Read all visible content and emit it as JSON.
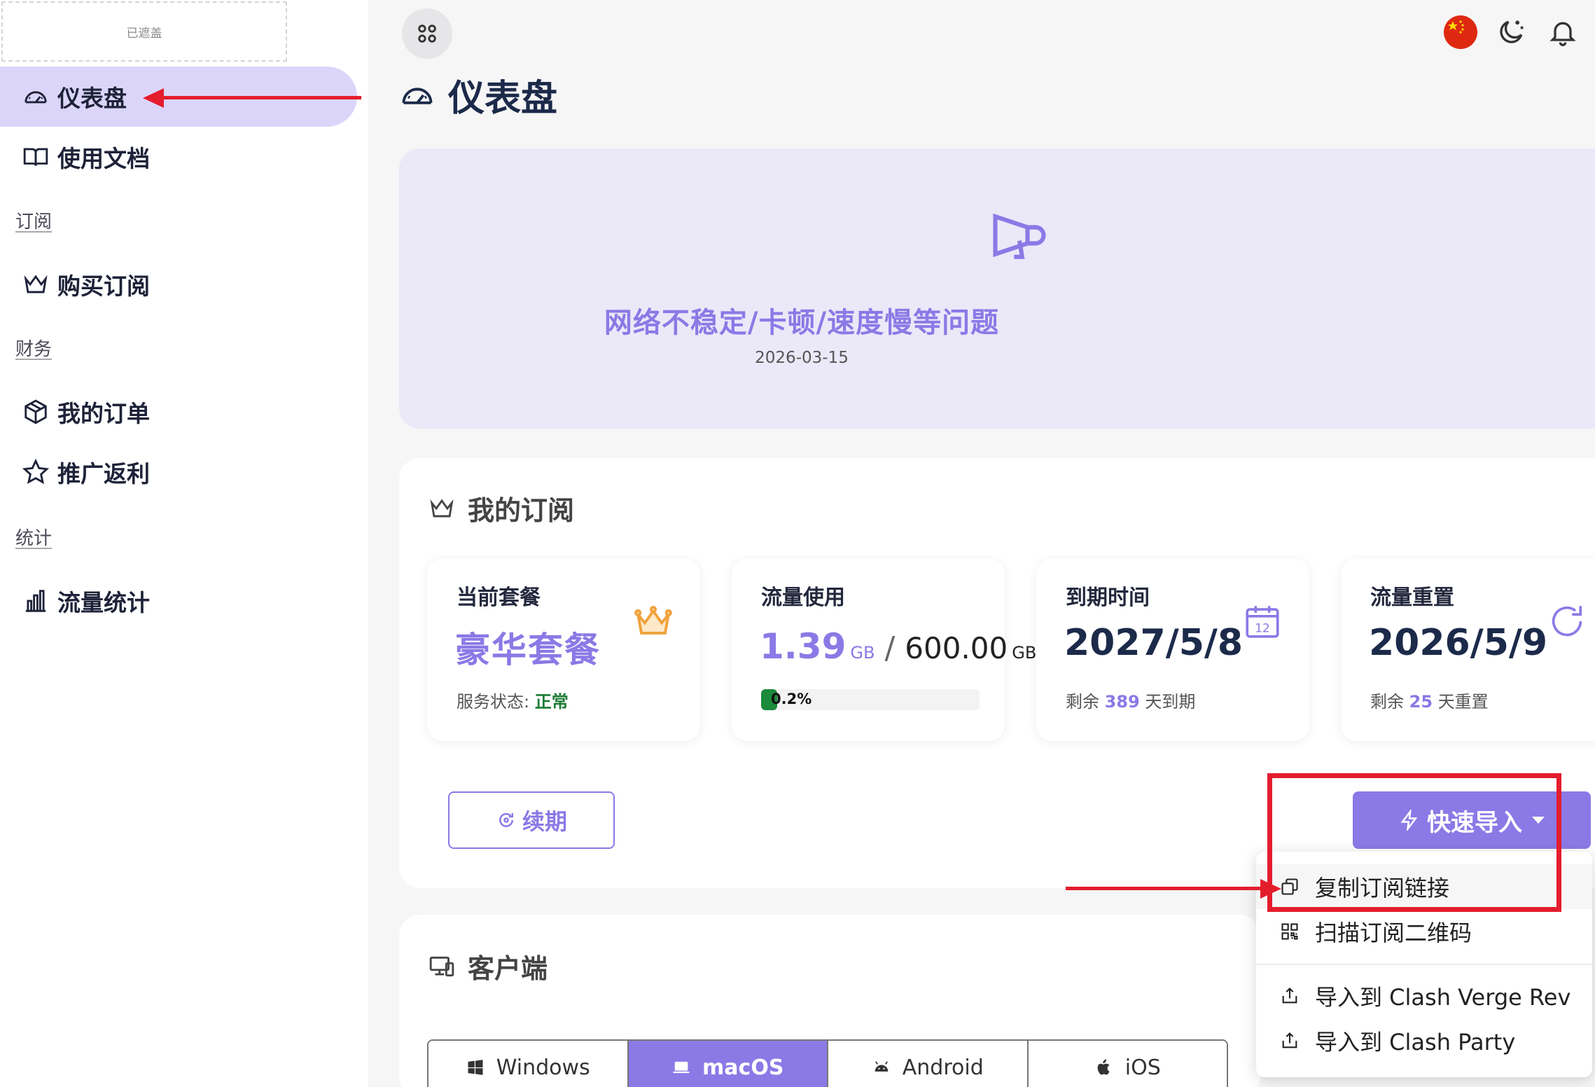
{
  "sidebar": {
    "logo_placeholder": "已遮盖",
    "items": [
      {
        "label": "仪表盘",
        "icon": "dashboard-icon",
        "active": true
      },
      {
        "label": "使用文档",
        "icon": "book-icon"
      },
      {
        "label": "购买订阅",
        "icon": "crown-icon"
      },
      {
        "label": "我的订单",
        "icon": "package-icon"
      },
      {
        "label": "推广返利",
        "icon": "star-icon"
      },
      {
        "label": "流量统计",
        "icon": "bar-chart-icon"
      }
    ],
    "groups": [
      "订阅",
      "财务",
      "统计"
    ]
  },
  "header": {
    "title": "仪表盘",
    "icons": [
      "grid-icon",
      "china-flag-icon",
      "moon-stars-icon",
      "bell-icon"
    ]
  },
  "announcement": {
    "title": "网络不稳定/卡顿/速度慢等问题",
    "date": "2026-03-15",
    "icon": "megaphone-icon"
  },
  "subscription": {
    "title": "我的订阅",
    "plan": {
      "label": "当前套餐",
      "name": "豪华套餐",
      "status_label": "服务状态:",
      "status": "正常"
    },
    "traffic": {
      "label": "流量使用",
      "used": "1.39",
      "used_unit": "GB",
      "slash": "/",
      "total": "600.00",
      "total_unit": "GB",
      "percent_text": "0.2%",
      "percent": 0.2
    },
    "expiry": {
      "label": "到期时间",
      "date": "2027/5/8",
      "prefix": "剩余",
      "days": "389",
      "suffix": "天到期"
    },
    "reset": {
      "label": "流量重置",
      "date": "2026/5/9",
      "prefix": "剩余",
      "days": "25",
      "suffix": "天重置"
    },
    "renew_label": "续期",
    "quick_import_label": "快速导入"
  },
  "dropdown": {
    "items": [
      {
        "label": "复制订阅链接",
        "icon": "copy-icon"
      },
      {
        "label": "扫描订阅二维码",
        "icon": "qr-code-icon"
      },
      {
        "label": "导入到 Clash Verge Rev",
        "icon": "share-icon"
      },
      {
        "label": "导入到 Clash Party",
        "icon": "share-icon"
      }
    ]
  },
  "clients": {
    "title": "客户端",
    "tabs": [
      {
        "label": "Windows",
        "icon": "windows-icon"
      },
      {
        "label": "macOS",
        "icon": "laptop-icon",
        "active": true
      },
      {
        "label": "Android",
        "icon": "android-icon"
      },
      {
        "label": "iOS",
        "icon": "apple-icon"
      }
    ]
  },
  "colors": {
    "accent": "#8b79e6",
    "active_nav": "#dcd5fa",
    "annotation": "#e41d2d",
    "ok": "#1b7a34"
  }
}
